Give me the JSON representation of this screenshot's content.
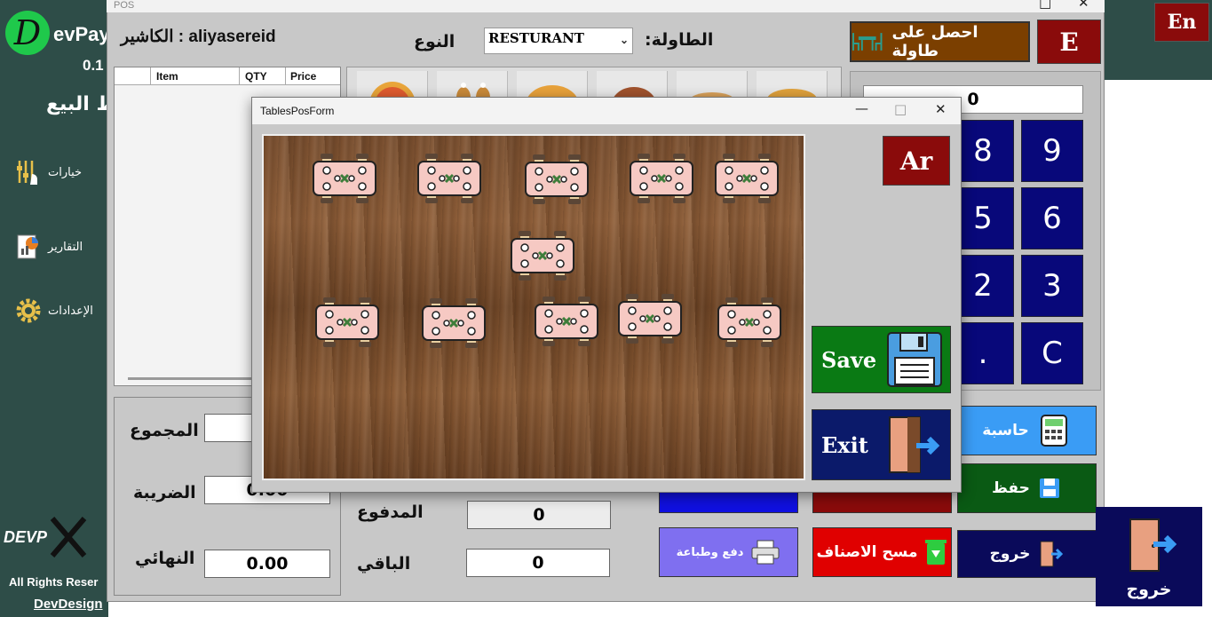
{
  "sidebar": {
    "logo_letter": "D",
    "brand": "evPay",
    "version": "0.1",
    "pos_title": "ط البيع",
    "items": [
      {
        "label": "خيارات",
        "icon": "sliders-icon"
      },
      {
        "label": "التقارير",
        "icon": "reports-icon"
      },
      {
        "label": "الإعدادات",
        "icon": "gear-icon"
      }
    ],
    "footer_logo": "DEVP",
    "rights": "All Rights Reser",
    "devdesign": "DevDesign"
  },
  "lang": {
    "en": "En",
    "e": "E",
    "ar": "Ar"
  },
  "pos": {
    "window_title": "POS",
    "cashier": "الكاشير : aliyasereid",
    "type_label": "النوع",
    "type_value": "RESTURANT",
    "table_label": ":الطاولة",
    "get_table": "احصل على طاولة",
    "items_columns": [
      "Item",
      "QTY",
      "Price"
    ],
    "display_value": "0",
    "numpad": [
      "8",
      "9",
      "5",
      "6",
      "2",
      "3",
      ".",
      "C"
    ],
    "totals": {
      "sum_label": "المجموع",
      "tax_label": "الضريبة",
      "tax_value": "0.00",
      "final_label": "النهائي",
      "final_value": "0.00"
    },
    "payment": {
      "paid_label": "المدفوع",
      "paid_value": "0",
      "rest_label": "الباقي",
      "rest_value": "0"
    },
    "buttons": {
      "calculator": "حاسبة",
      "save": "حفظ",
      "print_pay": "دفع وطباعة",
      "clear_items": "مسح الاصناف",
      "exit": "خروج",
      "exit_big": "خروج"
    }
  },
  "modal": {
    "title": "TablesPosForm",
    "save": "Save",
    "exit": "Exit",
    "table_count": 11
  }
}
